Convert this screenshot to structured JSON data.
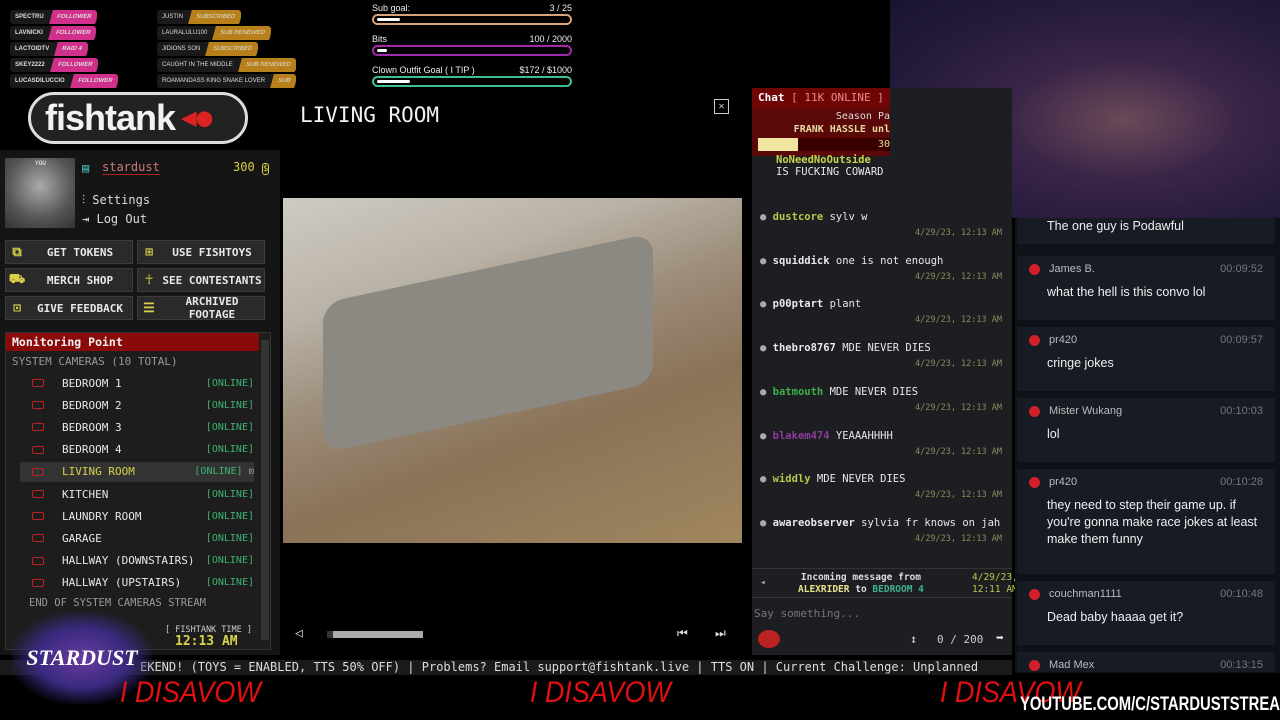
{
  "alerts_left": [
    {
      "name": "SPECTRU",
      "type": "FOLLOWER"
    },
    {
      "name": "LAVNICKI",
      "type": "FOLLOWER"
    },
    {
      "name": "LACTOIDTV",
      "type": "RAID 4"
    },
    {
      "name": "SKEY2222",
      "type": "FOLLOWER"
    },
    {
      "name": "LUCASDILUCCIO",
      "type": "FOLLOWER"
    }
  ],
  "alerts_right": [
    {
      "name": "JUSTIN",
      "type": "SUBSCRIBED"
    },
    {
      "name": "LAURALULU100",
      "type": "SUB RENEWED"
    },
    {
      "name": "JIDIONS SON",
      "type": "SUBSCRIBED"
    },
    {
      "name": "CAUGHT IN THE MIDDLE",
      "type": "SUB RENEWED"
    },
    {
      "name": "ROAMANDASS KING SNAKE LOVER",
      "type": "SUB"
    }
  ],
  "goals": [
    {
      "label": "Sub goal:",
      "value": "3 / 25",
      "progress": 0.12,
      "color": "#d9a37a"
    },
    {
      "label": "Bits",
      "value": "100 / 2000",
      "progress": 0.05,
      "color": "#a02aa8"
    },
    {
      "label": "Clown Outfit Goal ( I TIP )",
      "value": "$172 / $1000",
      "progress": 0.172,
      "color": "#3ec08e"
    }
  ],
  "logo": "fishtank",
  "profile": {
    "username": "stardust",
    "tokens": "300",
    "settings": "Settings",
    "logout": "Log Out",
    "avatar_label": "YOU"
  },
  "buttons": [
    {
      "label": "GET TOKENS",
      "icon": "tokens-icon"
    },
    {
      "label": "USE FISHTOYS",
      "icon": "gift-icon"
    },
    {
      "label": "MERCH SHOP",
      "icon": "cart-icon"
    },
    {
      "label": "SEE CONTESTANTS",
      "icon": "person-icon"
    },
    {
      "label": "GIVE FEEDBACK",
      "icon": "feedback-icon"
    },
    {
      "label": "ARCHIVED FOOTAGE",
      "icon": "archive-icon"
    }
  ],
  "monitor": {
    "title": "Monitoring Point",
    "subtitle": "SYSTEM CAMERAS (10 TOTAL)",
    "end": "END OF SYSTEM CAMERAS STREAM",
    "time_label": "[ FISHTANK TIME ]",
    "time": "12:13 AM",
    "cameras": [
      {
        "name": "BEDROOM 1",
        "status": "[ONLINE]"
      },
      {
        "name": "BEDROOM 2",
        "status": "[ONLINE]"
      },
      {
        "name": "BEDROOM 3",
        "status": "[ONLINE]"
      },
      {
        "name": "BEDROOM 4",
        "status": "[ONLINE]"
      },
      {
        "name": "LIVING ROOM",
        "status": "[ONLINE]",
        "active": true
      },
      {
        "name": "KITCHEN",
        "status": "[ONLINE]"
      },
      {
        "name": "LAUNDRY ROOM",
        "status": "[ONLINE]"
      },
      {
        "name": "GARAGE",
        "status": "[ONLINE]"
      },
      {
        "name": "HALLWAY (DOWNSTAIRS)",
        "status": "[ONLINE]"
      },
      {
        "name": "HALLWAY (UPSTAIRS)",
        "status": "[ONLINE]"
      }
    ]
  },
  "viewer": {
    "title": "LIVING ROOM",
    "close": "✕"
  },
  "chat": {
    "title": "Chat",
    "online": "[ 11K ONLINE ]",
    "season_line1": "Season Pa",
    "season_line2": "FRANK HASSLE unl",
    "season_pct": "30",
    "season_progress": 0.3,
    "partial": {
      "user": "NoNeedNoOutside",
      "text": "IS FUCKING COWARD"
    },
    "messages": [
      {
        "user": "dustcore",
        "color": "#b8c64a",
        "text": "sylv w",
        "time": "4/29/23, 12:13 AM"
      },
      {
        "user": "squiddick",
        "color": "#e8e8e8",
        "text": "one is not enough",
        "time": "4/29/23, 12:13 AM"
      },
      {
        "user": "p00ptart",
        "color": "#e8e8e8",
        "text": "plant",
        "time": "4/29/23, 12:13 AM"
      },
      {
        "user": "thebro8767",
        "color": "#e8e8e8",
        "text": "MDE NEVER DIES",
        "time": "4/29/23, 12:13 AM"
      },
      {
        "user": "batmouth",
        "color": "#3fae49",
        "text": "MDE NEVER DIES",
        "time": "4/29/23, 12:13 AM"
      },
      {
        "user": "blakem474",
        "color": "#8e3a9c",
        "text": "YEAAAHHHH",
        "time": "4/29/23, 12:13 AM"
      },
      {
        "user": "widdly",
        "color": "#b8c64a",
        "text": "MDE NEVER DIES",
        "time": "4/29/23, 12:13 AM"
      },
      {
        "user": "awareobserver",
        "color": "#e8e8e8",
        "text": "sylvia fr knows on jah",
        "time": "4/29/23, 12:13 AM"
      }
    ],
    "incoming": {
      "prefix": "Incoming message from",
      "from": "ALEXRIDER",
      "to_word": "to",
      "to": "BEDROOM 4",
      "time1": "4/29/23,",
      "time2": "12:11 AM"
    },
    "placeholder": "Say something...",
    "counter": "0 / 200"
  },
  "ticker": "EKEND! (TOYS = ENABLED, TTS 50% OFF) | Problems? Email support@fishtank.live | TTS ON | Current Challenge: Unplanned",
  "yt_chat": [
    {
      "user": "",
      "time": "",
      "text": "The one guy is Podawful"
    },
    {
      "user": "James B.",
      "time": "00:09:52",
      "text": "what the hell is this convo lol"
    },
    {
      "user": "pr420",
      "time": "00:09:57",
      "text": "cringe jokes"
    },
    {
      "user": "Mister Wukang",
      "time": "00:10:03",
      "text": "lol"
    },
    {
      "user": "pr420",
      "time": "00:10:28",
      "text": "they need to step their game up. if you're gonna make race jokes at least make them funny"
    },
    {
      "user": "couchman1111",
      "time": "00:10:48",
      "text": "Dead baby haaaa get it?"
    },
    {
      "user": "Mad Mex",
      "time": "00:13:15",
      "text": ""
    }
  ],
  "overlay": {
    "stardust_logo": "STARDUST",
    "disavow": "I DISAVOW",
    "youtube": "YOUTUBE.COM/C/STARDUSTSTREAMS"
  }
}
